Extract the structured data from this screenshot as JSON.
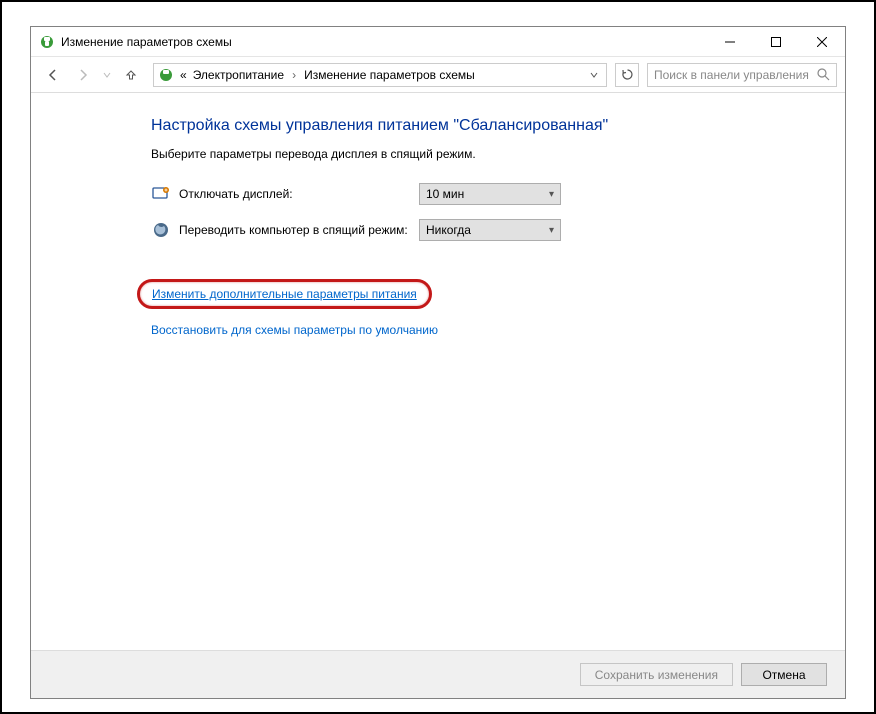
{
  "window": {
    "title": "Изменение параметров схемы"
  },
  "breadcrumb": {
    "prefix": "«",
    "item1": "Электропитание",
    "item2": "Изменение параметров схемы"
  },
  "search": {
    "placeholder": "Поиск в панели управления"
  },
  "main": {
    "heading": "Настройка схемы управления питанием \"Сбалансированная\"",
    "subtext": "Выберите параметры перевода дисплея в спящий режим.",
    "settings": [
      {
        "label": "Отключать дисплей:",
        "value": "10 мин"
      },
      {
        "label": "Переводить компьютер в спящий режим:",
        "value": "Никогда"
      }
    ],
    "link_advanced": "Изменить дополнительные параметры питания",
    "link_restore": "Восстановить для схемы параметры по умолчанию"
  },
  "footer": {
    "save": "Сохранить изменения",
    "cancel": "Отмена"
  }
}
